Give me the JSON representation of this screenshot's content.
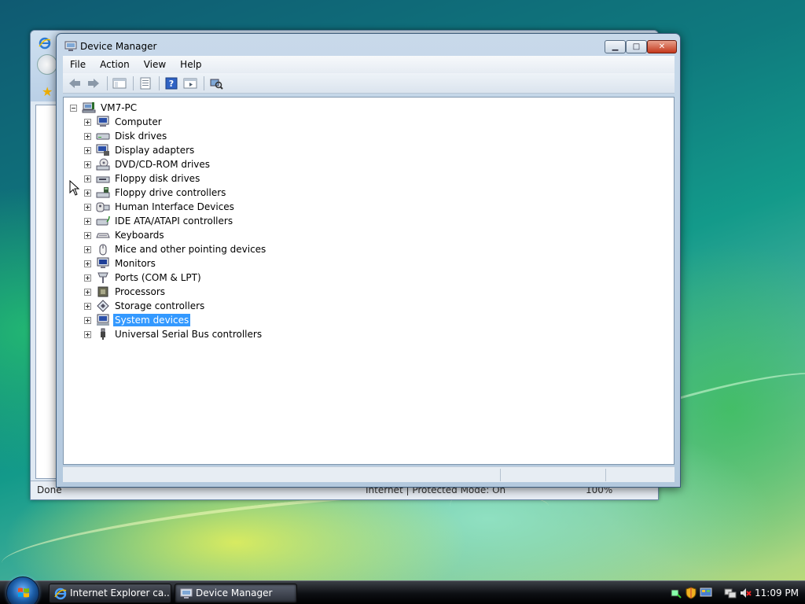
{
  "background_window": {
    "status_text": "Done",
    "zone_text": "Internet | Protected Mode: On",
    "zoom_text": "100%"
  },
  "device_manager": {
    "title": "Device Manager",
    "menu": [
      "File",
      "Action",
      "View",
      "Help"
    ],
    "tree": {
      "root": "VM7-PC",
      "children": [
        {
          "label": "Computer",
          "icon": "computer-icon"
        },
        {
          "label": "Disk drives",
          "icon": "disk-drive-icon"
        },
        {
          "label": "Display adapters",
          "icon": "display-adapter-icon"
        },
        {
          "label": "DVD/CD-ROM drives",
          "icon": "dvd-drive-icon"
        },
        {
          "label": "Floppy disk drives",
          "icon": "floppy-drive-icon"
        },
        {
          "label": "Floppy drive controllers",
          "icon": "floppy-controller-icon"
        },
        {
          "label": "Human Interface Devices",
          "icon": "hid-icon"
        },
        {
          "label": "IDE ATA/ATAPI controllers",
          "icon": "ide-controller-icon"
        },
        {
          "label": "Keyboards",
          "icon": "keyboard-icon"
        },
        {
          "label": "Mice and other pointing devices",
          "icon": "mouse-icon"
        },
        {
          "label": "Monitors",
          "icon": "monitor-icon"
        },
        {
          "label": "Ports (COM & LPT)",
          "icon": "port-icon"
        },
        {
          "label": "Processors",
          "icon": "processor-icon"
        },
        {
          "label": "Storage controllers",
          "icon": "storage-controller-icon"
        },
        {
          "label": "System devices",
          "icon": "system-device-icon",
          "selected": true
        },
        {
          "label": "Universal Serial Bus controllers",
          "icon": "usb-icon"
        }
      ]
    }
  },
  "taskbar": {
    "items": [
      {
        "label": "Internet Explorer ca...",
        "icon": "ie-icon"
      },
      {
        "label": "Device Manager",
        "icon": "device-manager-icon",
        "active": true
      }
    ],
    "clock": "11:09 PM"
  },
  "colors": {
    "selection": "#3399ff",
    "taskbar": "#1c1f25"
  }
}
